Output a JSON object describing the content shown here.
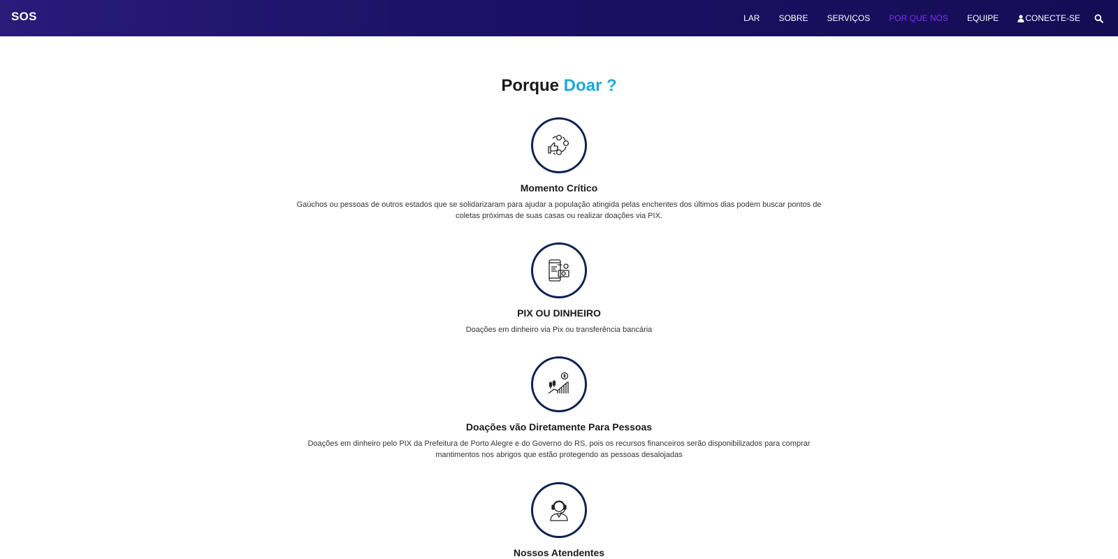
{
  "nav": {
    "brand": "SOS",
    "links": [
      {
        "label": "LAR"
      },
      {
        "label": "SOBRE"
      },
      {
        "label": "SERVIÇOS"
      },
      {
        "label": "POR QUE NÓS"
      },
      {
        "label": "EQUIPE"
      },
      {
        "label": "CONECTE-SE"
      }
    ],
    "active_index": 3,
    "icons": {
      "connect": "user-icon",
      "search": "search-icon"
    },
    "colors": {
      "background": "#1c1166",
      "active": "#7b2ff7",
      "text": "#ffffff"
    }
  },
  "section": {
    "title_prefix": "Porque",
    "title_accent": "Doar ?",
    "accent_color": "#1ba9d8"
  },
  "features": [
    {
      "icon": "social-network-icon",
      "title": "Momento Crítico",
      "description": "Gaúchos ou pessoas de outros estados que se solidarizaram para ajudar a população atingida pelas enchentes dos últimos dias podem buscar pontos de coletas próximas de suas casas ou realizar doações via PIX."
    },
    {
      "icon": "mobile-payment-icon",
      "title": "PIX OU DINHEIRO",
      "description": "Doações em dinheiro via Pix ou transferência bancária"
    },
    {
      "icon": "money-growth-icon",
      "title": "Doações vão Diretamente Para Pessoas",
      "description": "Doações em dinheiro pelo PIX da Prefeitura de Porto Alegre e do Governo do RS, pois os recursos financeiros serão disponibilizados para comprar mantimentos nos abrigos que estão protegendo as pessoas desalojadas"
    },
    {
      "icon": "support-agent-icon",
      "title": "Nossos Atendentes",
      "description": ""
    }
  ],
  "icon_circle_color": "#0e2150"
}
